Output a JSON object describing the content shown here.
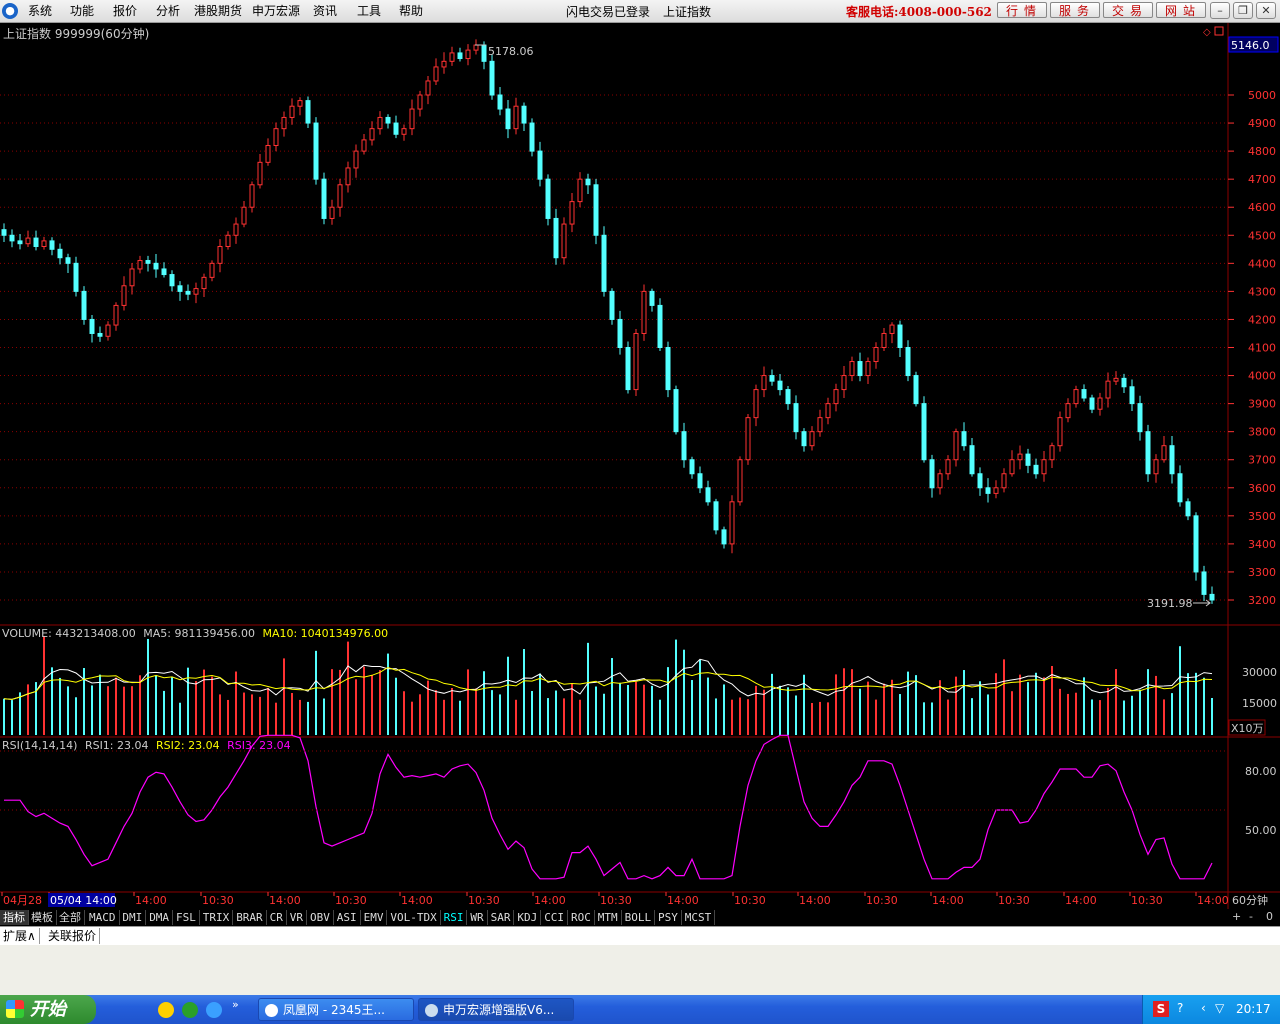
{
  "menu": {
    "items": [
      "系统",
      "功能",
      "报价",
      "分析",
      "港股期货",
      "申万宏源",
      "资讯",
      "工具",
      "帮助"
    ],
    "status_left": "闪电交易已登录",
    "status_right": "上证指数",
    "hotline": "客服电话:4008-000-562",
    "buttons": [
      "行情",
      "服务",
      "交易",
      "网站"
    ]
  },
  "chart": {
    "title": "上证指数 999999(60分钟)",
    "high_label": "5178.06",
    "low_label": "3191.98",
    "current_price": "5146.0",
    "price_ticks": [
      "5000",
      "4900",
      "4800",
      "4700",
      "4600",
      "4500",
      "4400",
      "4300",
      "4200",
      "4100",
      "4000",
      "3900",
      "3800",
      "3700",
      "3600",
      "3500",
      "3400",
      "3300",
      "3200"
    ],
    "volume_header": {
      "label": "VOLUME: 443213408.00",
      "ma5": "MA5: 981139456.00",
      "ma10": "MA10: 1040134976.00"
    },
    "volume_ticks": [
      "30000",
      "15000"
    ],
    "volume_unit": "X10万",
    "rsi_header": {
      "label": "RSI(14,14,14)",
      "rsi1": "RSI1: 23.04",
      "rsi2": "RSI2: 23.04",
      "rsi3": "RSI3: 23.04"
    },
    "rsi_ticks": [
      "80.00",
      "50.00"
    ],
    "time_labels": [
      "04月28",
      "05/04 14:00",
      "14:00",
      "10:30",
      "14:00",
      "10:30",
      "14:00",
      "10:30",
      "14:00",
      "10:30",
      "14:00",
      "10:30",
      "14:00",
      "10:30",
      "14:00",
      "10:30",
      "14:00",
      "10:30",
      "14:00"
    ],
    "period": "60分钟"
  },
  "chart_data": {
    "type": "candlestick",
    "title": "上证指数 999999(60分钟)",
    "ylim": [
      3150,
      5200
    ],
    "annotations": {
      "high": 5178.06,
      "low": 3191.98
    },
    "close_series": [
      4500,
      4480,
      4470,
      4490,
      4460,
      4480,
      4450,
      4420,
      4400,
      4300,
      4200,
      4150,
      4140,
      4180,
      4250,
      4320,
      4380,
      4410,
      4400,
      4380,
      4360,
      4320,
      4300,
      4290,
      4310,
      4350,
      4400,
      4460,
      4500,
      4540,
      4600,
      4680,
      4760,
      4820,
      4880,
      4920,
      4960,
      4980,
      4900,
      4700,
      4560,
      4600,
      4680,
      4740,
      4800,
      4840,
      4880,
      4920,
      4900,
      4860,
      4880,
      4950,
      5000,
      5050,
      5100,
      5120,
      5150,
      5130,
      5160,
      5178,
      5120,
      5000,
      4950,
      4880,
      4960,
      4900,
      4800,
      4700,
      4560,
      4420,
      4540,
      4620,
      4700,
      4680,
      4500,
      4300,
      4200,
      4100,
      3950,
      4150,
      4300,
      4250,
      4100,
      3950,
      3800,
      3700,
      3650,
      3600,
      3550,
      3450,
      3400,
      3550,
      3700,
      3850,
      3950,
      4000,
      3980,
      3950,
      3900,
      3800,
      3750,
      3800,
      3850,
      3900,
      3950,
      4000,
      4050,
      4000,
      4050,
      4100,
      4150,
      4180,
      4100,
      4000,
      3900,
      3700,
      3600,
      3650,
      3700,
      3800,
      3750,
      3650,
      3600,
      3580,
      3600,
      3650,
      3700,
      3720,
      3680,
      3650,
      3700,
      3750,
      3850,
      3900,
      3950,
      3920,
      3880,
      3920,
      3980,
      3990,
      3960,
      3900,
      3800,
      3650,
      3700,
      3750,
      3650,
      3550,
      3500,
      3300,
      3220,
      3200
    ],
    "volume_ticks": [
      15000,
      30000
    ],
    "volume_unit": "X10万",
    "rsi": {
      "params": [
        14,
        14,
        14
      ],
      "last": 23.04,
      "ylim": [
        0,
        100
      ]
    }
  },
  "tabs": [
    "指标",
    "模板",
    "全部",
    "MACD",
    "DMI",
    "DMA",
    "FSL",
    "TRIX",
    "BRAR",
    "CR",
    "VR",
    "OBV",
    "ASI",
    "EMV",
    "VOL-TDX",
    "RSI",
    "WR",
    "SAR",
    "KDJ",
    "CCI",
    "ROC",
    "MTM",
    "BOLL",
    "PSY",
    "MCST"
  ],
  "active_tab": "RSI",
  "ext_tabs": [
    "扩展∧",
    "关联报价"
  ],
  "taskbar": {
    "start": "开始",
    "tasks": [
      "凤凰网 - 2345王...",
      "申万宏源增强版V6..."
    ],
    "time": "20:17"
  },
  "colors": {
    "up": "#ff3232",
    "down": "#54ffff",
    "grid": "#8b0000",
    "rsi": "#ff00ff",
    "ma5": "#ffffff",
    "ma10": "#ffff00"
  }
}
